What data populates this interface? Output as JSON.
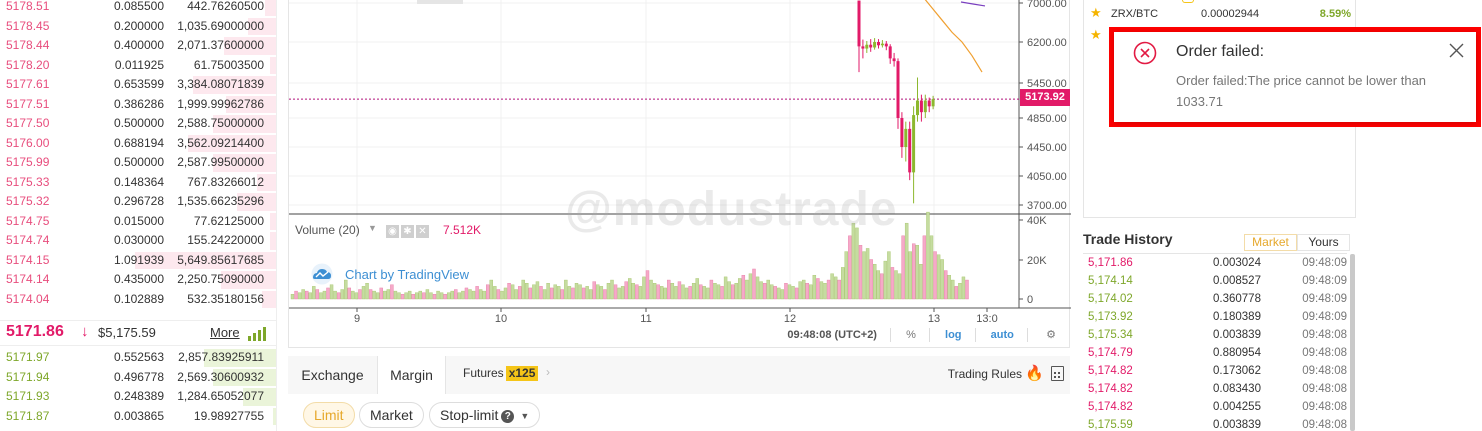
{
  "order_book": {
    "asks": [
      {
        "price": "5178.51",
        "amount": "0.085500",
        "total": "442.76260500",
        "depth": 0.04
      },
      {
        "price": "5178.45",
        "amount": "0.200000",
        "total": "1,035.69000000",
        "depth": 0.1
      },
      {
        "price": "5178.44",
        "amount": "0.400000",
        "total": "2,071.37600000",
        "depth": 0.19
      },
      {
        "price": "5178.20",
        "amount": "0.011925",
        "total": "61.75003500",
        "depth": 0.02
      },
      {
        "price": "5177.61",
        "amount": "0.653599",
        "total": "3,384.08071839",
        "depth": 0.3
      },
      {
        "price": "5177.51",
        "amount": "0.386286",
        "total": "1,999.99962786",
        "depth": 0.18
      },
      {
        "price": "5177.50",
        "amount": "0.500000",
        "total": "2,588.75000000",
        "depth": 0.23
      },
      {
        "price": "5176.00",
        "amount": "0.688194",
        "total": "3,562.09214400",
        "depth": 0.32
      },
      {
        "price": "5175.99",
        "amount": "0.500000",
        "total": "2,587.99500000",
        "depth": 0.23
      },
      {
        "price": "5175.33",
        "amount": "0.148364",
        "total": "767.83266012",
        "depth": 0.07
      },
      {
        "price": "5175.32",
        "amount": "0.296728",
        "total": "1,535.66235296",
        "depth": 0.14
      },
      {
        "price": "5174.75",
        "amount": "0.015000",
        "total": "77.62125000",
        "depth": 0.02
      },
      {
        "price": "5174.74",
        "amount": "0.030000",
        "total": "155.24220000",
        "depth": 0.02
      },
      {
        "price": "5174.15",
        "amount": "1.091939",
        "total": "5,649.85617685",
        "depth": 0.51
      },
      {
        "price": "5174.14",
        "amount": "0.435000",
        "total": "2,250.75090000",
        "depth": 0.2
      },
      {
        "price": "5174.04",
        "amount": "0.102889",
        "total": "532.35180156",
        "depth": 0.05
      }
    ],
    "last_price": "5171.86",
    "last_arrow": "↓",
    "last_usd": "$5,175.59",
    "more_label": "More",
    "bids": [
      {
        "price": "5171.97",
        "amount": "0.552563",
        "total": "2,857.83925911",
        "depth": 0.26
      },
      {
        "price": "5171.94",
        "amount": "0.496778",
        "total": "2,569.30600932",
        "depth": 0.23
      },
      {
        "price": "5171.93",
        "amount": "0.248389",
        "total": "1,284.65052077",
        "depth": 0.12
      },
      {
        "price": "5171.87",
        "amount": "0.003865",
        "total": "19.98927755",
        "depth": 0.01
      }
    ]
  },
  "chart": {
    "price_ticks": [
      "7000.00",
      "6200.00",
      "5450.00",
      "4850.00",
      "4450.00",
      "4050.00",
      "3700.00"
    ],
    "current_price": "5173.92",
    "watermark": "@modustrade",
    "volume_label": "Volume (20)",
    "volume_value": "7.512K",
    "volume_ticks": [
      "40K",
      "20K",
      "0"
    ],
    "time_ticks": [
      "9",
      "10",
      "11",
      "12",
      "13",
      "13:0"
    ],
    "tradingview_link": "Chart by TradingView",
    "footer": {
      "time": "09:48:08 (UTC+2)",
      "percent": "%",
      "log": "log",
      "auto": "auto"
    }
  },
  "chart_data": {
    "type": "candlestick",
    "x": [
      "9",
      "10",
      "11",
      "12",
      "13",
      "13:0"
    ],
    "price_axis": [
      "7000.00",
      "6200.00",
      "5450.00",
      "4850.00",
      "4450.00",
      "4050.00",
      "3700.00"
    ],
    "current_price": 5173.92,
    "volume_axis": [
      "40K",
      "20K",
      "0"
    ],
    "candles": [
      {
        "o": 7050,
        "c": 6120,
        "h": 7050,
        "l": 5650
      },
      {
        "o": 6120,
        "c": 6080,
        "h": 6250,
        "l": 5900
      },
      {
        "o": 6080,
        "c": 6150,
        "h": 6220,
        "l": 6000
      },
      {
        "o": 6150,
        "c": 6100,
        "h": 6260,
        "l": 6020
      },
      {
        "o": 6100,
        "c": 6200,
        "h": 6280,
        "l": 6060
      },
      {
        "o": 6200,
        "c": 6140,
        "h": 6260,
        "l": 6080
      },
      {
        "o": 6140,
        "c": 6170,
        "h": 6240,
        "l": 6100
      },
      {
        "o": 6170,
        "c": 6120,
        "h": 6220,
        "l": 6050
      },
      {
        "o": 6120,
        "c": 5900,
        "h": 6160,
        "l": 5800
      },
      {
        "o": 5900,
        "c": 5850,
        "h": 6000,
        "l": 5750
      },
      {
        "o": 5850,
        "c": 4850,
        "h": 5900,
        "l": 4700
      },
      {
        "o": 4850,
        "c": 4450,
        "h": 4950,
        "l": 4300
      },
      {
        "o": 4450,
        "c": 4700,
        "h": 4800,
        "l": 4250
      },
      {
        "o": 4700,
        "c": 4100,
        "h": 4800,
        "l": 4000
      },
      {
        "o": 4100,
        "c": 4900,
        "h": 5050,
        "l": 3720
      },
      {
        "o": 4900,
        "c": 5150,
        "h": 5550,
        "l": 4800
      },
      {
        "o": 5150,
        "c": 4950,
        "h": 5250,
        "l": 4800
      },
      {
        "o": 4950,
        "c": 5150,
        "h": 5250,
        "l": 4850
      },
      {
        "o": 5150,
        "c": 5050,
        "h": 5200,
        "l": 4950
      },
      {
        "o": 5050,
        "c": 5174,
        "h": 5230,
        "l": 5000
      }
    ],
    "ma_lines": [
      {
        "color": "#f0a030",
        "values": [
          7150,
          6900,
          6650,
          6400,
          6200,
          5950,
          5650
        ]
      },
      {
        "color": "#7a3fbf",
        "values": [
          7020,
          6980,
          6940
        ]
      }
    ],
    "volumes": [
      3,
      5,
      4,
      6,
      5,
      4,
      8,
      6,
      4,
      5,
      7,
      9,
      5,
      4,
      6,
      12,
      7,
      5,
      4,
      6,
      8,
      10,
      6,
      5,
      4,
      7,
      5,
      6,
      9,
      5,
      4,
      3,
      4,
      5,
      3,
      4,
      5,
      4,
      6,
      4,
      3,
      5,
      4,
      3,
      4,
      5,
      6,
      4,
      5,
      7,
      6,
      5,
      8,
      6,
      5,
      9,
      12,
      8,
      6,
      5,
      7,
      10,
      9,
      6,
      8,
      12,
      10,
      7,
      9,
      11,
      8,
      6,
      10,
      7,
      9,
      8,
      6,
      12,
      8,
      7,
      10,
      9,
      7,
      8,
      6,
      11,
      9,
      8,
      6,
      10,
      12,
      9,
      7,
      8,
      11,
      13,
      10,
      9,
      8,
      14,
      18,
      12,
      10,
      9,
      8,
      7,
      12,
      10,
      8,
      11,
      9,
      7,
      8,
      10,
      13,
      9,
      8,
      7,
      12,
      10,
      9,
      8,
      14,
      11,
      9,
      10,
      13,
      15,
      12,
      16,
      19,
      14,
      11,
      10,
      12,
      9,
      8,
      7,
      6,
      10,
      9,
      8,
      7,
      11,
      12,
      10,
      9,
      15,
      13,
      11,
      10,
      12,
      16,
      14,
      12,
      20,
      30,
      40,
      48,
      45,
      34,
      30,
      32,
      25,
      22,
      18,
      16,
      24,
      30,
      20,
      18,
      16,
      40,
      48,
      30,
      35,
      34,
      22,
      40,
      55,
      40,
      30,
      28,
      25,
      18,
      15,
      12,
      8,
      10,
      14,
      12
    ]
  },
  "trade_form": {
    "tabs": [
      "Exchange",
      "Margin"
    ],
    "futures_label": "Futures",
    "futures_badge": "x125",
    "trading_rules": "Trading Rules",
    "order_types": [
      "Limit",
      "Market",
      "Stop-limit"
    ]
  },
  "market": {
    "symbol": "ZRX/BTC",
    "price": "0.00002944",
    "change": "8.59%"
  },
  "trade_history": {
    "title": "Trade History",
    "filters": [
      "Market",
      "Yours"
    ],
    "rows": [
      {
        "price": "5,171.86",
        "amount": "0.003024",
        "time": "09:48:09",
        "side": "down"
      },
      {
        "price": "5,174.14",
        "amount": "0.008527",
        "time": "09:48:09",
        "side": "up"
      },
      {
        "price": "5,174.02",
        "amount": "0.360778",
        "time": "09:48:09",
        "side": "up"
      },
      {
        "price": "5,173.92",
        "amount": "0.180389",
        "time": "09:48:09",
        "side": "up"
      },
      {
        "price": "5,175.34",
        "amount": "0.003839",
        "time": "09:48:08",
        "side": "up"
      },
      {
        "price": "5,174.79",
        "amount": "0.880954",
        "time": "09:48:08",
        "side": "down"
      },
      {
        "price": "5,174.82",
        "amount": "0.173062",
        "time": "09:48:08",
        "side": "down"
      },
      {
        "price": "5,174.82",
        "amount": "0.083430",
        "time": "09:48:08",
        "side": "down"
      },
      {
        "price": "5,174.82",
        "amount": "0.004255",
        "time": "09:48:08",
        "side": "down"
      },
      {
        "price": "5,175.59",
        "amount": "0.003839",
        "time": "09:48:08",
        "side": "up"
      }
    ]
  },
  "notification": {
    "title": "Order failed:",
    "message": "Order failed:The price cannot be lower than 1033.71"
  },
  "colors": {
    "ask": "#e84d7d",
    "bid": "#7ea72a",
    "accent": "#e6a82b",
    "alert_border": "#ff0000"
  }
}
